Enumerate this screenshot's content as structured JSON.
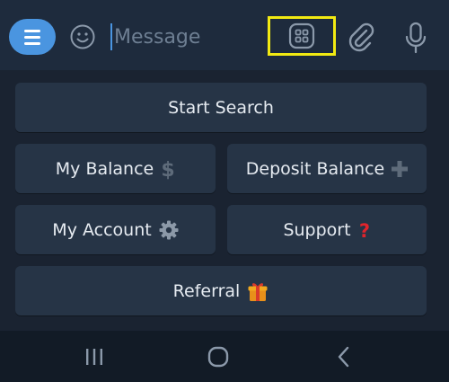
{
  "composer": {
    "placeholder": "Message",
    "icons": {
      "menu": "hamburger-menu-icon",
      "emoji": "smiley-icon",
      "commands": "bot-commands-grid-icon",
      "attach": "paperclip-icon",
      "mic": "microphone-icon"
    },
    "colors": {
      "accent": "#4a95e0",
      "highlight": "#f2ea12"
    }
  },
  "keyboard": {
    "buttons": [
      {
        "label": "Start Search",
        "icon": ""
      },
      {
        "label": "My Balance",
        "icon": "dollar-icon"
      },
      {
        "label": "Deposit Balance",
        "icon": "plus-icon"
      },
      {
        "label": "My Account",
        "icon": "gear-icon"
      },
      {
        "label": "Support",
        "icon": "question-mark-icon"
      },
      {
        "label": "Referral",
        "icon": "gift-icon"
      }
    ]
  },
  "navbar": {
    "icons": [
      "recents-icon",
      "home-icon",
      "back-icon"
    ]
  }
}
